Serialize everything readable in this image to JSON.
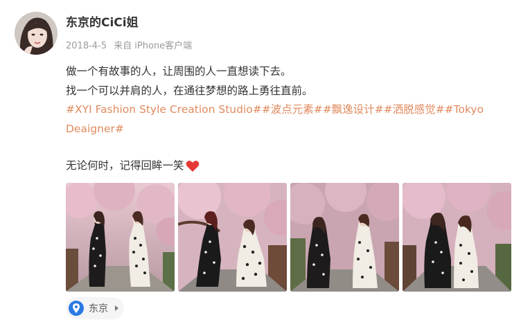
{
  "post": {
    "author": "东京的CiCi姐",
    "date": "2018-4-5",
    "source": "来自 iPhone客户端",
    "lines": [
      "做一个有故事的人，让周围的人一直想读下去。",
      "找一个可以并肩的人，在通往梦想的路上勇往直前。"
    ],
    "tags": "#XYI Fashion Style Creation Studio##波点元素##飘逸设计##洒脱感觉##Tokyo Deaigner#",
    "quote": "无论何时，记得回眸一笑"
  },
  "photos": [
    {
      "name": "photo-1",
      "icon": "photo"
    },
    {
      "name": "photo-2",
      "icon": "photo"
    },
    {
      "name": "photo-3",
      "icon": "photo"
    },
    {
      "name": "photo-4",
      "icon": "photo"
    }
  ],
  "location": {
    "label": "东京",
    "icon": "location-pin-icon",
    "color": "#2a7ae2"
  },
  "colors": {
    "tag": "#e08a5e",
    "meta": "#9b9b9b",
    "heart": "#e53935"
  }
}
